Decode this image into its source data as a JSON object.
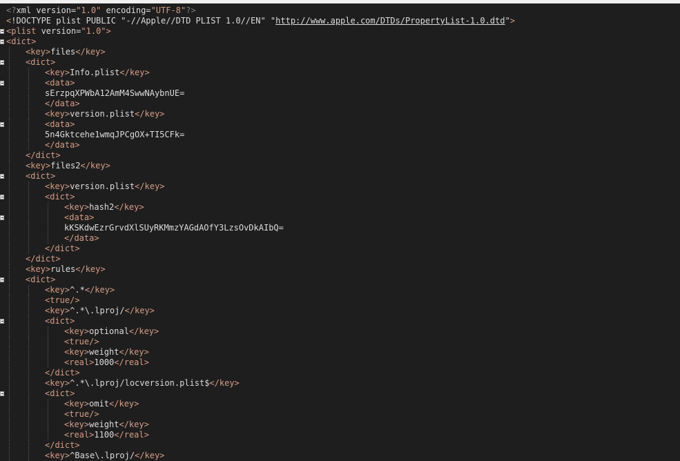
{
  "editor": {
    "lines": [
      {
        "indent": 0,
        "fold": false,
        "segments": [
          [
            "p",
            "<?"
          ],
          [
            "x",
            "xml version="
          ],
          [
            "s",
            "\"1.0\""
          ],
          [
            "x",
            " encoding="
          ],
          [
            "s",
            "\"UTF-8\""
          ],
          [
            "p",
            "?>"
          ]
        ]
      },
      {
        "indent": 0,
        "fold": false,
        "segments": [
          [
            "t",
            "<"
          ],
          [
            "doc",
            "!DOCTYPE plist PUBLIC \"-//Apple//DTD PLIST 1.0//EN\" \""
          ],
          [
            "u",
            "http://www.apple.com/DTDs/PropertyList-1.0.dtd"
          ],
          [
            "doc",
            "\""
          ],
          [
            "t",
            ">"
          ]
        ]
      },
      {
        "indent": 0,
        "fold": true,
        "segments": [
          [
            "t",
            "<plist"
          ],
          [
            "x",
            " version="
          ],
          [
            "s",
            "\"1.0\""
          ],
          [
            "t",
            ">"
          ]
        ]
      },
      {
        "indent": 0,
        "fold": true,
        "segments": [
          [
            "t",
            "<dict>"
          ]
        ]
      },
      {
        "indent": 1,
        "fold": false,
        "segments": [
          [
            "t",
            "<key>"
          ],
          [
            "x",
            "files"
          ],
          [
            "t",
            "</key>"
          ]
        ]
      },
      {
        "indent": 1,
        "fold": true,
        "segments": [
          [
            "t",
            "<dict>"
          ]
        ]
      },
      {
        "indent": 2,
        "fold": false,
        "segments": [
          [
            "t",
            "<key>"
          ],
          [
            "x",
            "Info.plist"
          ],
          [
            "t",
            "</key>"
          ]
        ]
      },
      {
        "indent": 2,
        "fold": true,
        "segments": [
          [
            "t",
            "<data>"
          ]
        ]
      },
      {
        "indent": 2,
        "fold": false,
        "segments": [
          [
            "x",
            "sErzpqXPWbA12AmM4SwwNAybnUE="
          ]
        ]
      },
      {
        "indent": 2,
        "fold": false,
        "segments": [
          [
            "t",
            "</data>"
          ]
        ]
      },
      {
        "indent": 2,
        "fold": false,
        "segments": [
          [
            "t",
            "<key>"
          ],
          [
            "x",
            "version.plist"
          ],
          [
            "t",
            "</key>"
          ]
        ]
      },
      {
        "indent": 2,
        "fold": true,
        "segments": [
          [
            "t",
            "<data>"
          ]
        ]
      },
      {
        "indent": 2,
        "fold": false,
        "segments": [
          [
            "x",
            "5n4Gktcehe1wmqJPCgOX+TI5CFk="
          ]
        ]
      },
      {
        "indent": 2,
        "fold": false,
        "segments": [
          [
            "t",
            "</data>"
          ]
        ]
      },
      {
        "indent": 1,
        "fold": false,
        "segments": [
          [
            "t",
            "</dict>"
          ]
        ]
      },
      {
        "indent": 1,
        "fold": false,
        "segments": [
          [
            "t",
            "<key>"
          ],
          [
            "x",
            "files2"
          ],
          [
            "t",
            "</key>"
          ]
        ]
      },
      {
        "indent": 1,
        "fold": true,
        "segments": [
          [
            "t",
            "<dict>"
          ]
        ]
      },
      {
        "indent": 2,
        "fold": false,
        "segments": [
          [
            "t",
            "<key>"
          ],
          [
            "x",
            "version.plist"
          ],
          [
            "t",
            "</key>"
          ]
        ]
      },
      {
        "indent": 2,
        "fold": true,
        "segments": [
          [
            "t",
            "<dict>"
          ]
        ]
      },
      {
        "indent": 3,
        "fold": false,
        "segments": [
          [
            "t",
            "<key>"
          ],
          [
            "x",
            "hash2"
          ],
          [
            "t",
            "</key>"
          ]
        ]
      },
      {
        "indent": 3,
        "fold": true,
        "segments": [
          [
            "t",
            "<data>"
          ]
        ]
      },
      {
        "indent": 3,
        "fold": false,
        "segments": [
          [
            "x",
            "kKSKdwEzrGrvdXlSUyRKMmzYAGdAOfY3LzsOvDkAIbQ="
          ]
        ]
      },
      {
        "indent": 3,
        "fold": false,
        "segments": [
          [
            "t",
            "</data>"
          ]
        ]
      },
      {
        "indent": 2,
        "fold": false,
        "segments": [
          [
            "t",
            "</dict>"
          ]
        ]
      },
      {
        "indent": 1,
        "fold": false,
        "segments": [
          [
            "t",
            "</dict>"
          ]
        ]
      },
      {
        "indent": 1,
        "fold": false,
        "segments": [
          [
            "t",
            "<key>"
          ],
          [
            "x",
            "rules"
          ],
          [
            "t",
            "</key>"
          ]
        ]
      },
      {
        "indent": 1,
        "fold": true,
        "segments": [
          [
            "t",
            "<dict>"
          ]
        ]
      },
      {
        "indent": 2,
        "fold": false,
        "segments": [
          [
            "t",
            "<key>"
          ],
          [
            "x",
            "^.*"
          ],
          [
            "t",
            "</key>"
          ]
        ]
      },
      {
        "indent": 2,
        "fold": false,
        "segments": [
          [
            "t",
            "<true/>"
          ]
        ]
      },
      {
        "indent": 2,
        "fold": false,
        "segments": [
          [
            "t",
            "<key>"
          ],
          [
            "x",
            "^.*\\.lproj/"
          ],
          [
            "t",
            "</key>"
          ]
        ]
      },
      {
        "indent": 2,
        "fold": true,
        "segments": [
          [
            "t",
            "<dict>"
          ]
        ]
      },
      {
        "indent": 3,
        "fold": false,
        "segments": [
          [
            "t",
            "<key>"
          ],
          [
            "x",
            "optional"
          ],
          [
            "t",
            "</key>"
          ]
        ]
      },
      {
        "indent": 3,
        "fold": false,
        "segments": [
          [
            "t",
            "<true/>"
          ]
        ]
      },
      {
        "indent": 3,
        "fold": false,
        "segments": [
          [
            "t",
            "<key>"
          ],
          [
            "x",
            "weight"
          ],
          [
            "t",
            "</key>"
          ]
        ]
      },
      {
        "indent": 3,
        "fold": false,
        "segments": [
          [
            "t",
            "<real>"
          ],
          [
            "x",
            "1000"
          ],
          [
            "t",
            "</real>"
          ]
        ]
      },
      {
        "indent": 2,
        "fold": false,
        "segments": [
          [
            "t",
            "</dict>"
          ]
        ]
      },
      {
        "indent": 2,
        "fold": false,
        "segments": [
          [
            "t",
            "<key>"
          ],
          [
            "x",
            "^.*\\.lproj/locversion.plist$"
          ],
          [
            "t",
            "</key>"
          ]
        ]
      },
      {
        "indent": 2,
        "fold": true,
        "segments": [
          [
            "t",
            "<dict>"
          ]
        ]
      },
      {
        "indent": 3,
        "fold": false,
        "segments": [
          [
            "t",
            "<key>"
          ],
          [
            "x",
            "omit"
          ],
          [
            "t",
            "</key>"
          ]
        ]
      },
      {
        "indent": 3,
        "fold": false,
        "segments": [
          [
            "t",
            "<true/>"
          ]
        ]
      },
      {
        "indent": 3,
        "fold": false,
        "segments": [
          [
            "t",
            "<key>"
          ],
          [
            "x",
            "weight"
          ],
          [
            "t",
            "</key>"
          ]
        ]
      },
      {
        "indent": 3,
        "fold": false,
        "segments": [
          [
            "t",
            "<real>"
          ],
          [
            "x",
            "1100"
          ],
          [
            "t",
            "</real>"
          ]
        ]
      },
      {
        "indent": 2,
        "fold": false,
        "segments": [
          [
            "t",
            "</dict>"
          ]
        ]
      },
      {
        "indent": 2,
        "fold": false,
        "segments": [
          [
            "t",
            "<key>"
          ],
          [
            "x",
            "^Base\\.lproj/"
          ],
          [
            "t",
            "</key>"
          ]
        ]
      }
    ]
  },
  "colors": {
    "background": "#1e1e1e",
    "tag": "#d69d85",
    "text": "#dcdcdc",
    "punctuation": "#808080"
  }
}
